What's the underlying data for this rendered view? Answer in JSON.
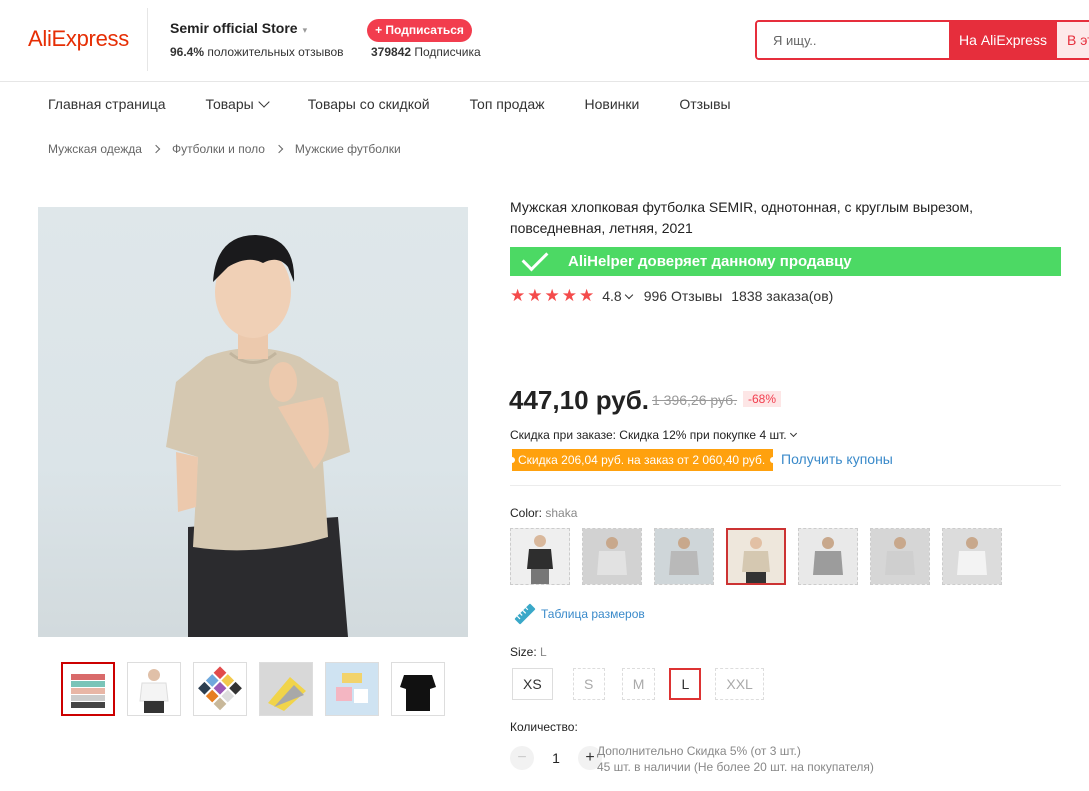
{
  "header": {
    "logo": "AliExpress",
    "store_name": "Semir official Store",
    "rating_percent": "96.4%",
    "rating_text": "положительных отзывов",
    "subscribe_label": "+ Подписаться",
    "followers_count": "379842",
    "followers_text": "Подписчика",
    "search_placeholder": "Я ищу..",
    "search_btn_aliexpress": "На AliExpress",
    "search_btn_store": "В этом"
  },
  "nav": {
    "items": [
      "Главная страница",
      "Товары",
      "Товары со скидкой",
      "Топ продаж",
      "Новинки",
      "Отзывы"
    ]
  },
  "breadcrumb": [
    "Мужская одежда",
    "Футболки и поло",
    "Мужские футболки"
  ],
  "product": {
    "title": "Мужская хлопковая футболка SEMIR, однотонная, с круглым вырезом, повседневная, летняя, 2021",
    "trust_banner": "AliHelper доверяет данному продавцу",
    "stars": 5,
    "rating": "4.8",
    "reviews": "996 Отзывы",
    "orders": "1838 заказа(ов)",
    "price": "447,10 руб.",
    "old_price": "1 396,26 руб.",
    "discount": "-68%",
    "order_discount": "Скидка при заказе: Скидка 12% при покупке 4 шт.",
    "coupon_tag": "Скидка 206,04 руб. на заказ от 2 060,40 руб.",
    "coupon_link": "Получить купоны",
    "color_label": "Color:",
    "color_value": "shaka",
    "size_chart_label": "Таблица размеров",
    "size_label": "Size:",
    "size_value": "L",
    "sizes": [
      "XS",
      "S",
      "M",
      "L",
      "XXL"
    ],
    "quantity_label": "Количество:",
    "quantity": "1",
    "qty_extra": "Дополнительно Скидка 5% (от 3 шт.)",
    "stock": "45 шт. в наличии (Не более 20 шт. на покупателя)"
  },
  "colors": {
    "accent": "#e62e3c",
    "trust_green": "#4cd964",
    "coupon_orange": "#ffa10e",
    "link_blue": "#3a8aca"
  }
}
